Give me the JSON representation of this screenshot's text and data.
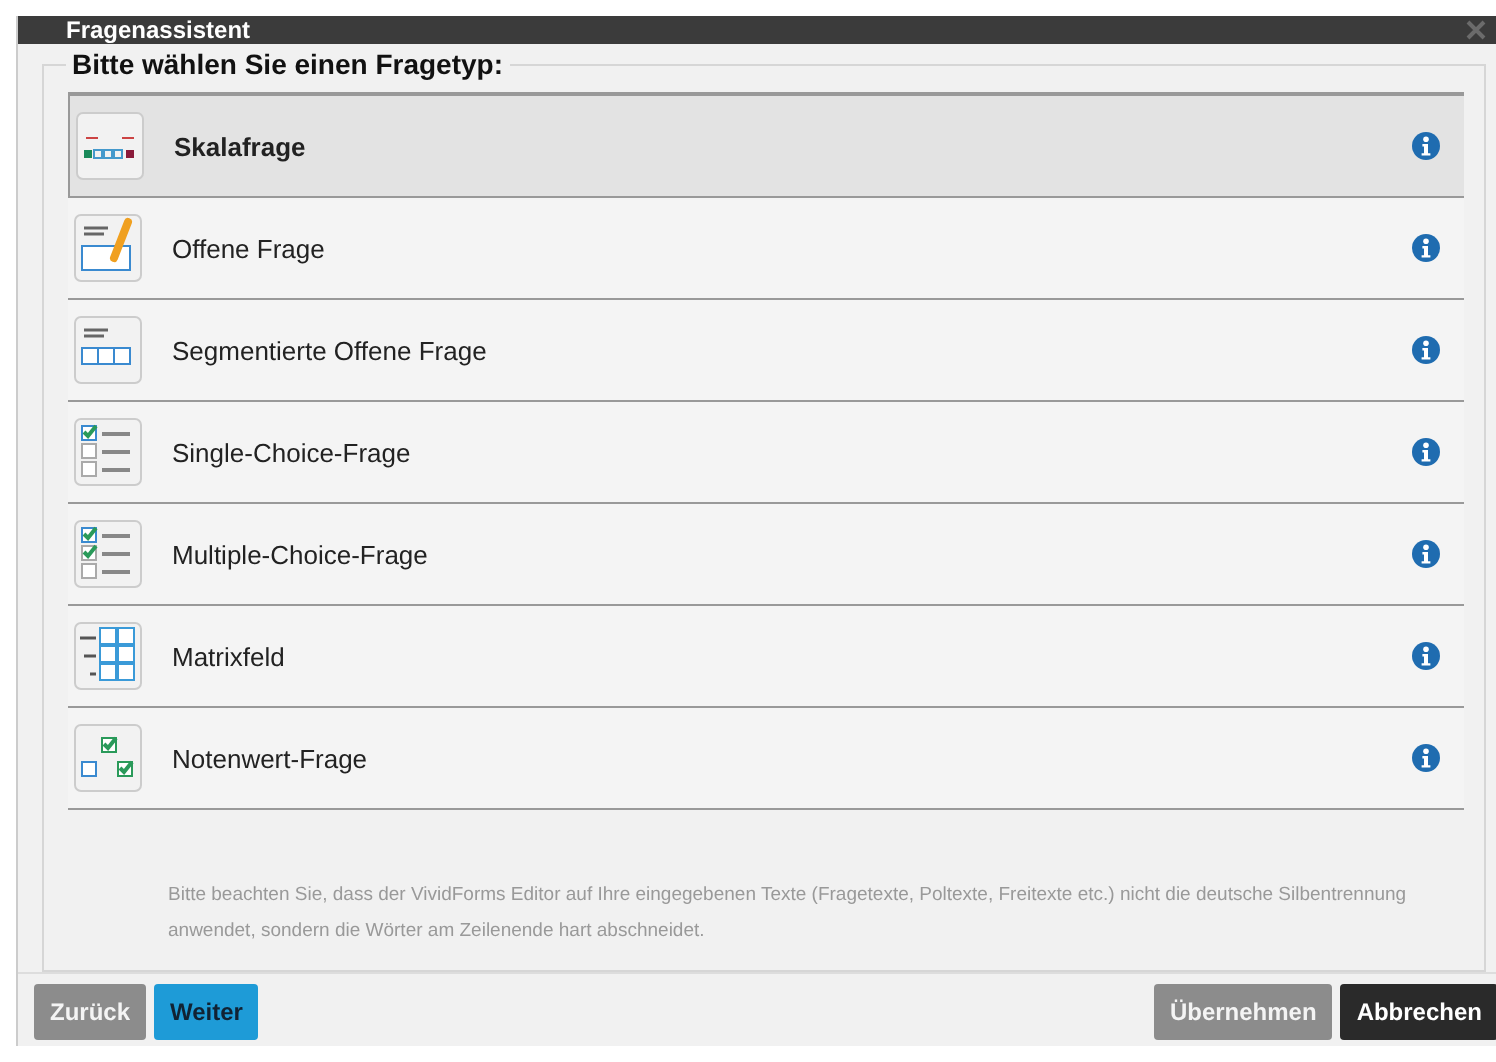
{
  "window": {
    "title": "Fragenassistent"
  },
  "prompt": "Bitte wählen Sie einen Fragetyp:",
  "question_types": [
    {
      "kind": "scale",
      "label": "Skalafrage",
      "selected": true
    },
    {
      "kind": "open",
      "label": "Offene Frage",
      "selected": false
    },
    {
      "kind": "segmented",
      "label": "Segmentierte Offene Frage",
      "selected": false
    },
    {
      "kind": "single",
      "label": "Single-Choice-Frage",
      "selected": false
    },
    {
      "kind": "multiple",
      "label": "Multiple-Choice-Frage",
      "selected": false
    },
    {
      "kind": "matrix",
      "label": "Matrixfeld",
      "selected": false
    },
    {
      "kind": "grade",
      "label": "Notenwert-Frage",
      "selected": false
    }
  ],
  "note": "Bitte beachten Sie, dass der VividForms Editor auf Ihre eingegebenen Texte (Fragetexte, Poltexte, Freitexte etc.) nicht die deutsche Silbentrennung anwendet, sondern die Wörter am Zeilenende hart abschneidet.",
  "buttons_left": [
    {
      "label": "Zurück",
      "kind": "grey",
      "disabled": true
    },
    {
      "label": "Weiter",
      "kind": "blue",
      "disabled": false
    }
  ],
  "buttons_right": [
    {
      "label": "Übernehmen",
      "kind": "grey",
      "disabled": true
    },
    {
      "label": "Abbrechen",
      "kind": "dark",
      "disabled": false
    }
  ]
}
